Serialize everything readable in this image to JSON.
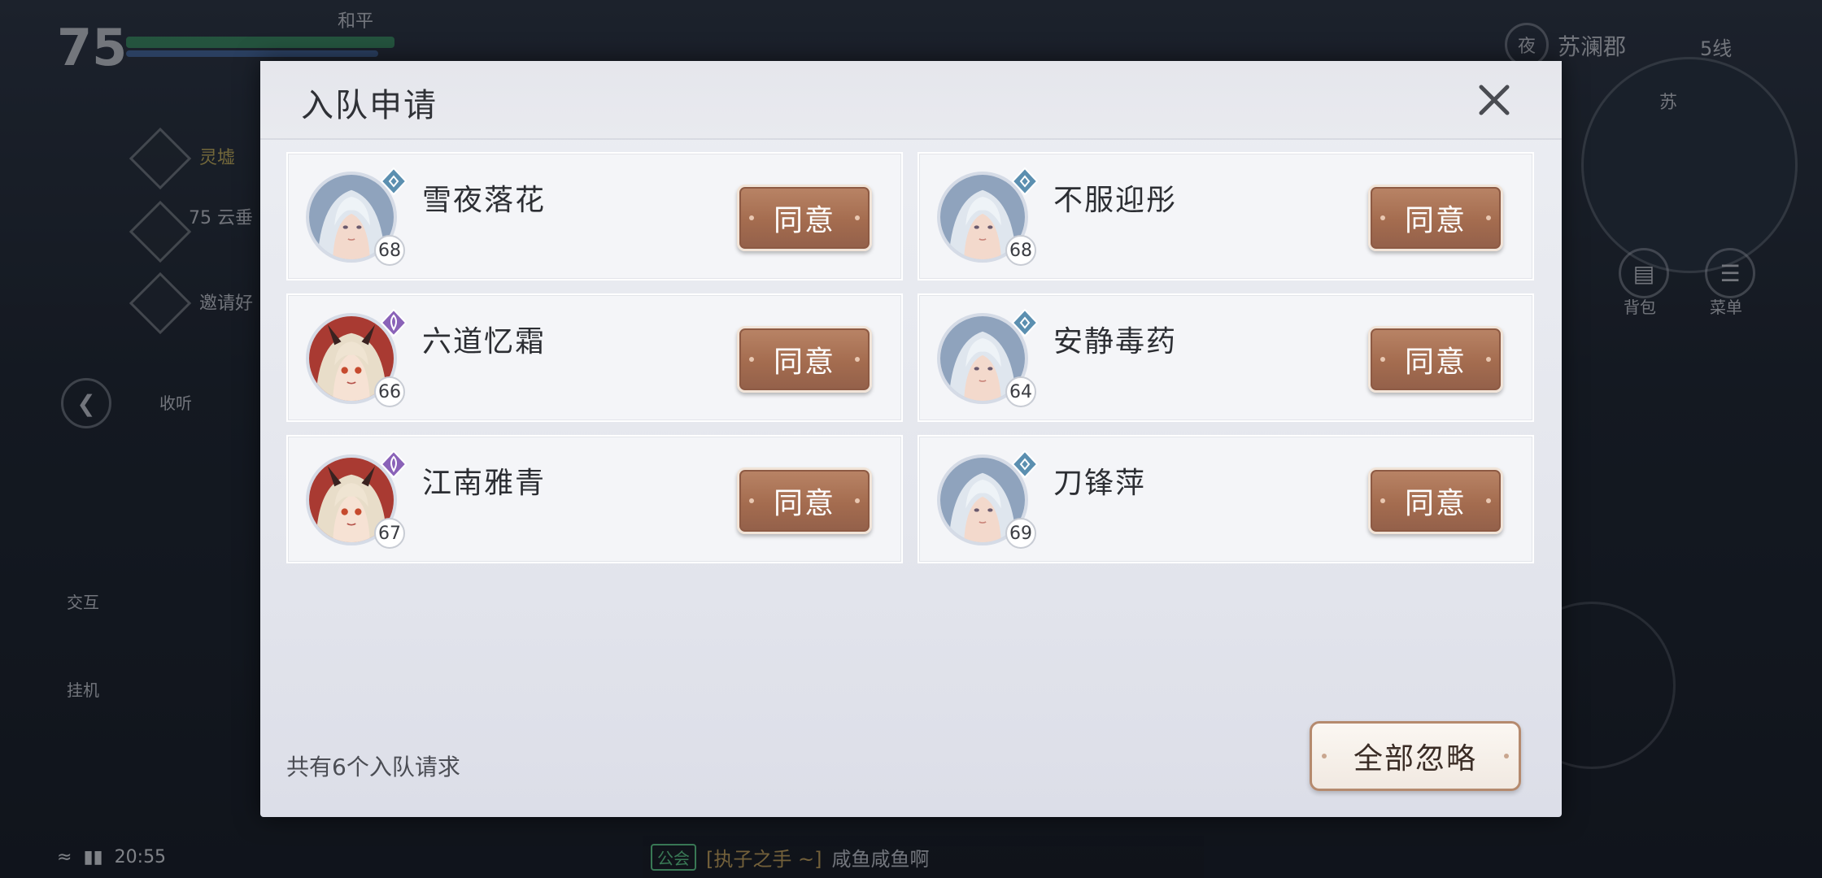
{
  "hud": {
    "player_level": "75",
    "pk_mode": "和平",
    "location": "苏澜郡",
    "time_of_day_icon": "夜",
    "server_line": "5线",
    "map_label": "苏",
    "clock": "20:55",
    "side_labels": [
      "收听",
      "交互",
      "挂机",
      "背包",
      "菜单"
    ],
    "tasks": [
      "灵墟",
      "75 云垂",
      "邀请好"
    ],
    "chat_channel": "公会",
    "chat_guild": "[执子之手 ~]",
    "chat_message": "咸鱼咸鱼啊"
  },
  "modal": {
    "title": "入队申请",
    "footer_count": "共有6个入队请求",
    "ignore_all_label": "全部忽略",
    "agree_label": "同意",
    "requests": [
      {
        "name": "雪夜落花",
        "level": "68",
        "avatar": "male-silver-hair",
        "class": "blue-diamond"
      },
      {
        "name": "不服迎彤",
        "level": "68",
        "avatar": "male-silver-hair",
        "class": "blue-diamond"
      },
      {
        "name": "六道忆霜",
        "level": "66",
        "avatar": "female-horned",
        "class": "purple-flame"
      },
      {
        "name": "安静毒药",
        "level": "64",
        "avatar": "male-silver-hair",
        "class": "blue-diamond"
      },
      {
        "name": "江南雅青",
        "level": "67",
        "avatar": "female-horned",
        "class": "purple-flame"
      },
      {
        "name": "刀锋萍",
        "level": "69",
        "avatar": "male-silver-hair",
        "class": "blue-diamond"
      }
    ]
  },
  "colors": {
    "agree_button": "#a46c4f",
    "ignore_border": "#b58a6e",
    "class_blue": "#5b8fb0",
    "class_purple": "#8a62b8"
  }
}
